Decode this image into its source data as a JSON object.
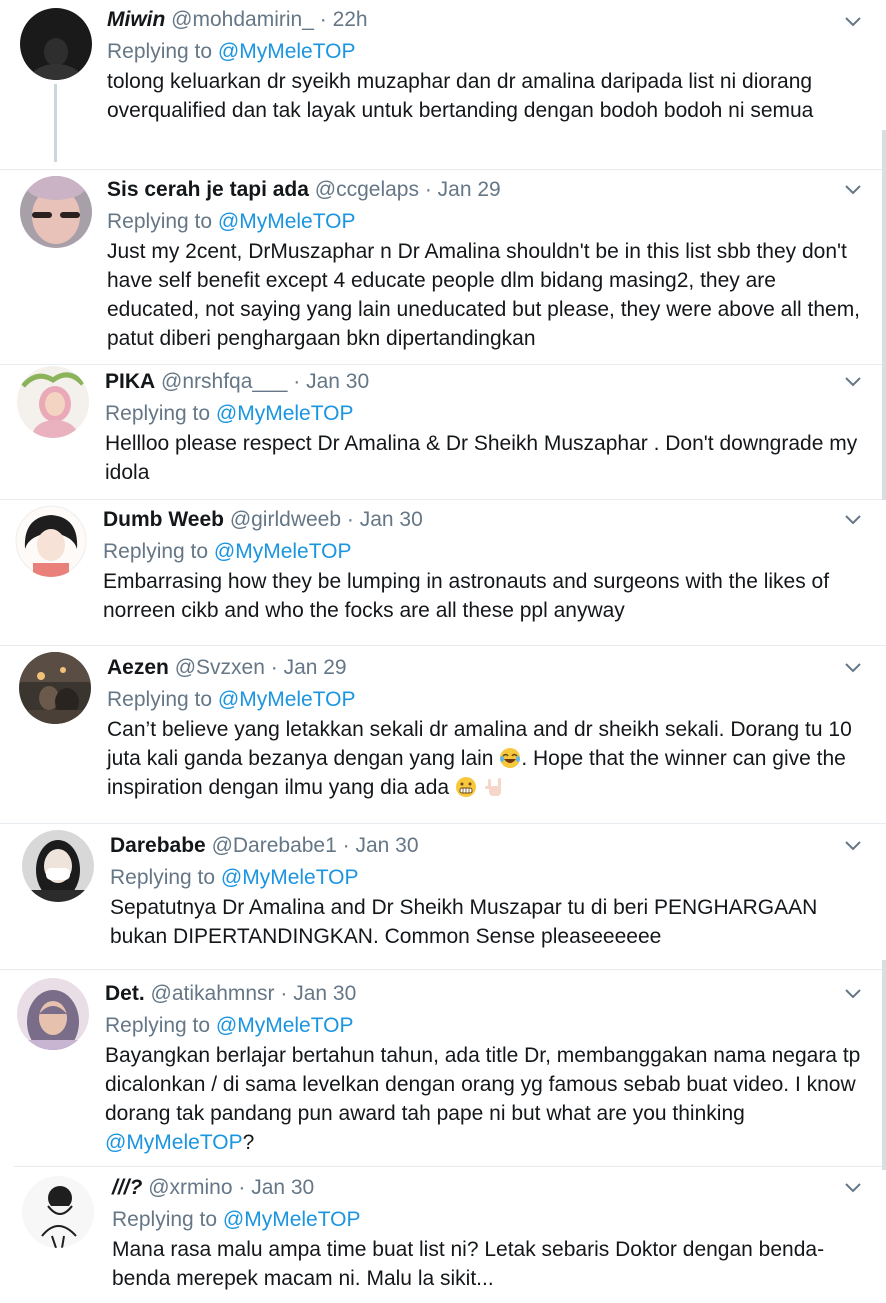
{
  "tweets": [
    {
      "name": "Miwin",
      "handle": "@mohdamirin_",
      "time": "22h",
      "reply_prefix": "Replying to",
      "reply_to": "@MyMeleTOP",
      "text": "tolong keluarkan dr syeikh muzaphar dan dr amalina daripada list ni diorang overqualified dan tak layak untuk bertanding dengan bodoh bodoh ni semua"
    },
    {
      "name": "Sis cerah je tapi ada",
      "handle": "@ccgelaps",
      "time": "Jan 29",
      "reply_prefix": "Replying to",
      "reply_to": "@MyMeleTOP",
      "text": "Just my 2cent, DrMuszaphar n Dr Amalina shouldn't be in this list  sbb they don't have self benefit except 4 educate people dlm bidang masing2, they are educated, not saying yang lain uneducated but please, they were above all them, patut diberi penghargaan bkn dipertandingkan"
    },
    {
      "name": "PIKA",
      "handle": "@nrshfqa___",
      "time": "Jan 30",
      "reply_prefix": "Replying to",
      "reply_to": "@MyMeleTOP",
      "text": "Hellloo please respect Dr Amalina & Dr Sheikh Muszaphar . Don't downgrade my idola"
    },
    {
      "name": "Dumb Weeb",
      "handle": "@girldweeb",
      "time": "Jan 30",
      "reply_prefix": "Replying to",
      "reply_to": "@MyMeleTOP",
      "text": "Embarrasing how they be lumping in astronauts and surgeons with the likes of norreen cikb and who the focks are all these ppl anyway"
    },
    {
      "name": "Aezen",
      "handle": "@Svzxen",
      "time": "Jan 29",
      "reply_prefix": "Replying to",
      "reply_to": "@MyMeleTOP",
      "text_a": "Can’t believe yang letakkan sekali dr amalina and dr sheikh sekali. Dorang tu 10 juta kali ganda bezanya dengan yang lain ",
      "text_b": ". Hope that the winner can give the inspiration dengan ilmu yang dia ada ",
      "emoji_1": "face-with-tears-of-joy-emoji",
      "emoji_2": "grimacing-face-emoji",
      "emoji_3": "sign-of-horns-emoji"
    },
    {
      "name": "Darebabe",
      "handle": "@Darebabe1",
      "time": "Jan 30",
      "reply_prefix": "Replying to",
      "reply_to": "@MyMeleTOP",
      "text": "Sepatutnya Dr Amalina and Dr Sheikh Muszapar tu di beri PENGHARGAAN bukan DIPERTANDINGKAN. Common Sense pleaseeeeee"
    },
    {
      "name": "Det.",
      "handle": "@atikahmnsr",
      "time": "Jan 30",
      "reply_prefix": "Replying to",
      "reply_to": "@MyMeleTOP",
      "text_a": "Bayangkan berlajar bertahun tahun, ada title Dr, membanggakan nama negara tp dicalonkan / di sama levelkan dengan orang yg famous sebab buat video. I know dorang tak pandang pun award tah pape ni but what are you thinking ",
      "text_mention": "@MyMeleTOP",
      "text_b": "?"
    },
    {
      "name": "///?",
      "handle": "@xrmino",
      "time": "Jan 30",
      "reply_prefix": "Replying to",
      "reply_to": "@MyMeleTOP",
      "text": "Mana rasa malu ampa time buat list ni? Letak sebaris Doktor dengan benda-benda merepek macam ni. Malu la sikit..."
    }
  ],
  "icons": {
    "more": "chevron-down-icon"
  },
  "colors": {
    "link": "#1b95e0",
    "secondary_text": "#657786",
    "primary_text": "#14171a",
    "divider": "#e6ecf0"
  }
}
